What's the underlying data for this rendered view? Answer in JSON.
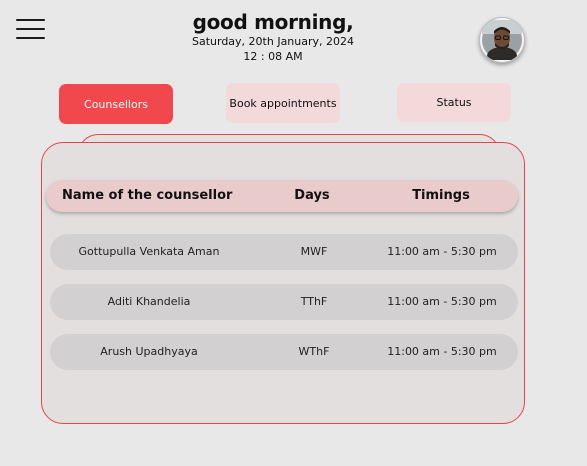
{
  "header": {
    "greeting": "good morning,",
    "date": "Saturday, 20th January, 2024",
    "time": "12 : 08 AM"
  },
  "icons": {
    "menu": "hamburger-menu-icon",
    "profile": "profile-avatar"
  },
  "tabs": [
    {
      "label": "Counsellors",
      "active": true
    },
    {
      "label": "Book appointments",
      "active": false
    },
    {
      "label": "Status",
      "active": false
    }
  ],
  "table": {
    "headers": {
      "name": "Name of the counsellor",
      "days": "Days",
      "timings": "Timings"
    },
    "rows": [
      {
        "name": "Gottupulla Venkata Aman",
        "days": "MWF",
        "timings": "11:00 am - 5:30 pm"
      },
      {
        "name": "Aditi Khandelia",
        "days": "TThF",
        "timings": "11:00 am - 5:30 pm"
      },
      {
        "name": "Arush Upadhyaya",
        "days": "WThF",
        "timings": "11:00 am - 5:30 pm"
      }
    ]
  },
  "colors": {
    "accent": "#f0484c",
    "tab_inactive": "#f4d9da",
    "border": "#e2484b",
    "header_bg": "#eacbcc",
    "row_bg": "#d2d0d0"
  }
}
